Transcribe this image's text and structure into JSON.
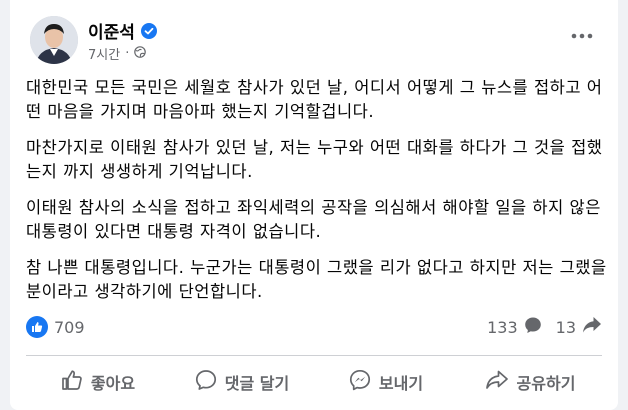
{
  "post": {
    "author": "이준석",
    "time": "7시간",
    "paragraphs": [
      "대한민국 모든 국민은 세월호 참사가 있던 날, 어디서 어떻게 그 뉴스를 접하고 어떤 마음을 가지며 마음아파 했는지 기억할겁니다.",
      "마찬가지로 이태원 참사가 있던 날, 저는 누구와 어떤 대화를 하다가 그 것을 접했는지 까지 생생하게 기억납니다.",
      "이태원 참사의 소식을 접하고 좌익세력의 공작을 의심해서 해야할 일을 하지 않은 대통령이 있다면 대통령 자격이 없습니다.",
      "참 나쁜 대통령입니다. 누군가는 대통령이 그랬을 리가 없다고 하지만 저는 그랬을 분이라고 생각하기에 단언합니다."
    ],
    "likes": "709",
    "comments": "133",
    "shares": "13"
  },
  "actions": {
    "like": "좋아요",
    "comment": "댓글 달기",
    "send": "보내기",
    "share": "공유하기"
  },
  "colors": {
    "accent": "#1877f2",
    "muted": "#65676b",
    "background": "#f0f2f5"
  },
  "icons": [
    "verified-badge-icon",
    "globe-icon",
    "more-options-icon",
    "like-icon",
    "comment-icon",
    "share-icon",
    "messenger-icon"
  ]
}
